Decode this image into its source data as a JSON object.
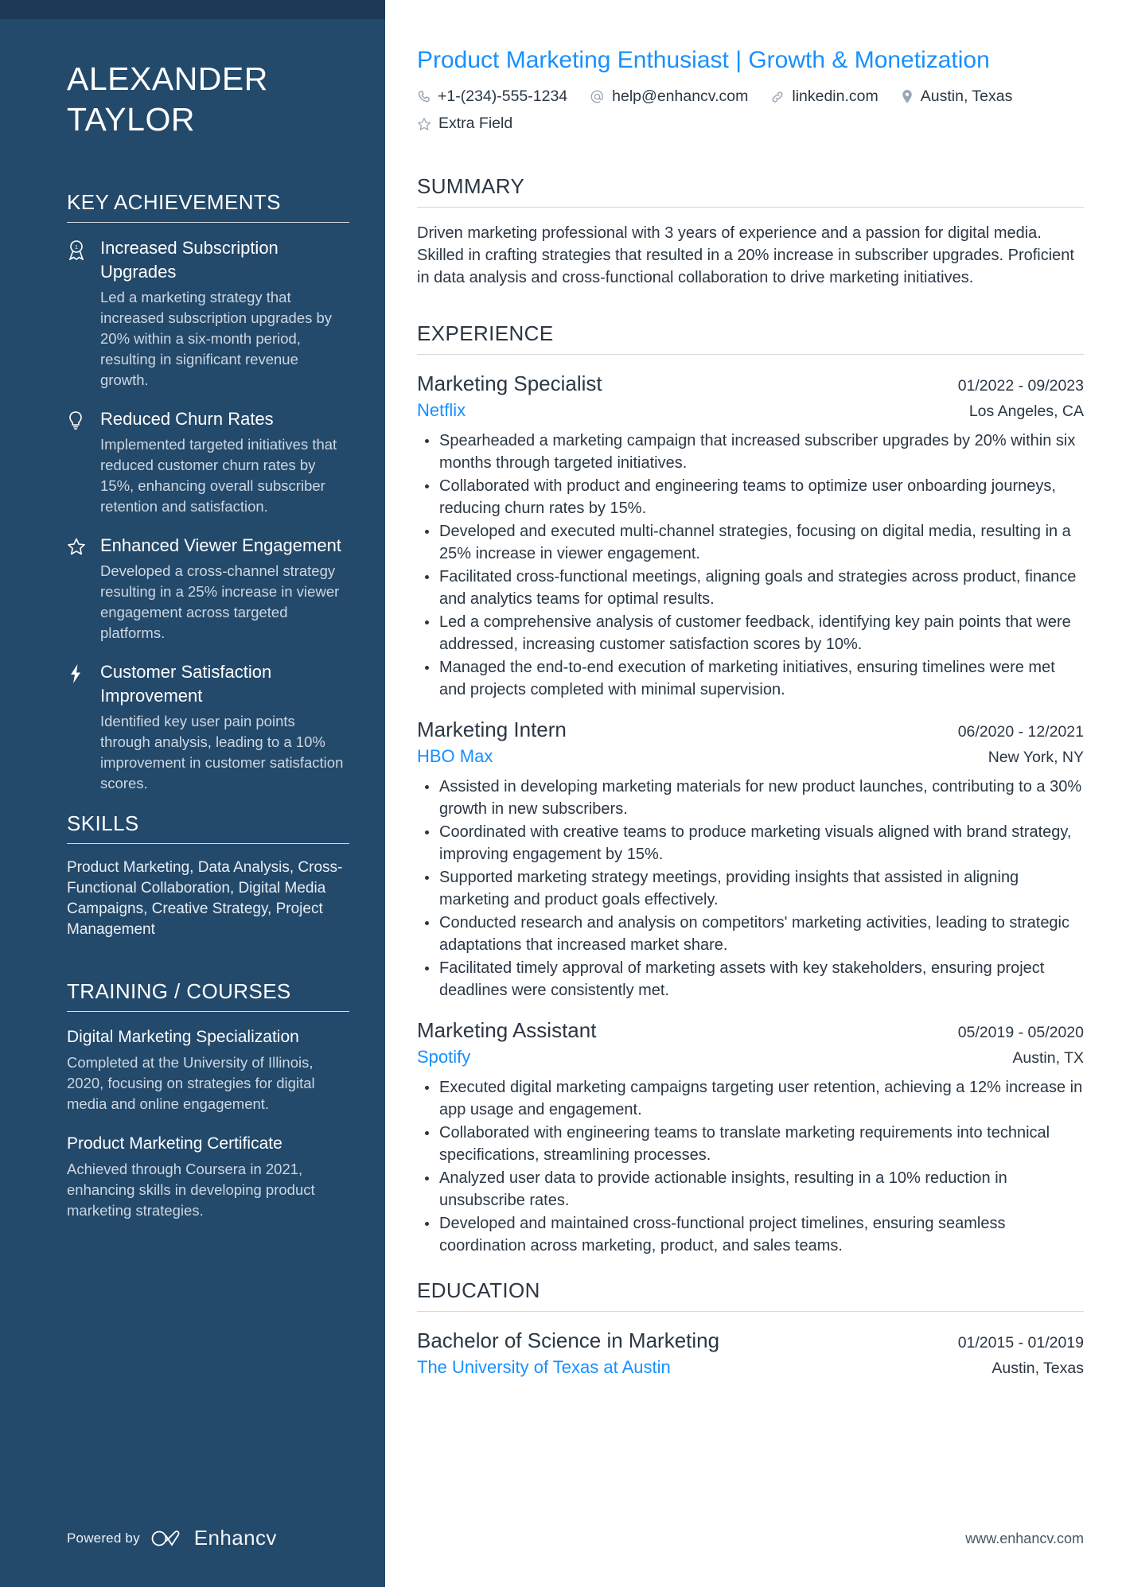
{
  "sidebar": {
    "name_lines": [
      "ALEXANDER",
      "TAYLOR"
    ],
    "achievements_heading": "KEY ACHIEVEMENTS",
    "achievements": [
      {
        "icon": "award-ribbon-icon",
        "title": "Increased Subscription Upgrades",
        "description": "Led a marketing strategy that increased subscription upgrades by 20% within a six-month period, resulting in significant revenue growth."
      },
      {
        "icon": "lightbulb-icon",
        "title": "Reduced Churn Rates",
        "description": "Implemented targeted initiatives that reduced customer churn rates by 15%, enhancing overall subscriber retention and satisfaction."
      },
      {
        "icon": "star-icon",
        "title": "Enhanced Viewer Engagement",
        "description": "Developed a cross-channel strategy resulting in a 25% increase in viewer engagement across targeted platforms."
      },
      {
        "icon": "lightning-bolt-icon",
        "title": "Customer Satisfaction Improvement",
        "description": "Identified key user pain points through analysis, leading to a 10% improvement in customer satisfaction scores."
      }
    ],
    "skills_heading": "SKILLS",
    "skills_text": "Product Marketing, Data Analysis, Cross-Functional Collaboration, Digital Media Campaigns, Creative Strategy, Project Management",
    "training_heading": "TRAINING / COURSES",
    "courses": [
      {
        "title": "Digital Marketing Specialization",
        "description": "Completed at the University of Illinois, 2020, focusing on strategies for digital media and online engagement."
      },
      {
        "title": "Product Marketing Certificate",
        "description": "Achieved through Coursera in 2021, enhancing skills in developing product marketing strategies."
      }
    ],
    "footer": {
      "powered_by": "Powered by",
      "brand": "Enhancv"
    }
  },
  "main": {
    "headline": "Product Marketing Enthusiast | Growth & Monetization",
    "contacts": [
      {
        "icon": "phone-icon",
        "value": "+1-(234)-555-1234"
      },
      {
        "icon": "at-email-icon",
        "value": "help@enhancv.com"
      },
      {
        "icon": "link-icon",
        "value": "linkedin.com"
      },
      {
        "icon": "map-pin-icon",
        "value": "Austin, Texas"
      },
      {
        "icon": "star-icon",
        "value": "Extra Field"
      }
    ],
    "summary_heading": "SUMMARY",
    "summary_text": "Driven marketing professional with 3 years of experience and a passion for digital media. Skilled in crafting strategies that resulted in a 20% increase in subscriber upgrades. Proficient in data analysis and cross-functional collaboration to drive marketing initiatives.",
    "experience_heading": "EXPERIENCE",
    "jobs": [
      {
        "title": "Marketing Specialist",
        "dates": "01/2022 - 09/2023",
        "company": "Netflix",
        "location": "Los Angeles, CA",
        "bullets": [
          "Spearheaded a marketing campaign that increased subscriber upgrades by 20% within six months through targeted initiatives.",
          "Collaborated with product and engineering teams to optimize user onboarding journeys, reducing churn rates by 15%.",
          "Developed and executed multi-channel strategies, focusing on digital media, resulting in a 25% increase in viewer engagement.",
          "Facilitated cross-functional meetings, aligning goals and strategies across product, finance and analytics teams for optimal results.",
          "Led a comprehensive analysis of customer feedback, identifying key pain points that were addressed, increasing customer satisfaction scores by 10%.",
          "Managed the end-to-end execution of marketing initiatives, ensuring timelines were met and projects completed with minimal supervision."
        ]
      },
      {
        "title": "Marketing Intern",
        "dates": "06/2020 - 12/2021",
        "company": "HBO Max",
        "location": "New York, NY",
        "bullets": [
          "Assisted in developing marketing materials for new product launches, contributing to a 30% growth in new subscribers.",
          "Coordinated with creative teams to produce marketing visuals aligned with brand strategy, improving engagement by 15%.",
          "Supported marketing strategy meetings, providing insights that assisted in aligning marketing and product goals effectively.",
          "Conducted research and analysis on competitors' marketing activities, leading to strategic adaptations that increased market share.",
          "Facilitated timely approval of marketing assets with key stakeholders, ensuring project deadlines were consistently met."
        ]
      },
      {
        "title": "Marketing Assistant",
        "dates": "05/2019 - 05/2020",
        "company": "Spotify",
        "location": "Austin, TX",
        "bullets": [
          "Executed digital marketing campaigns targeting user retention, achieving a 12% increase in app usage and engagement.",
          "Collaborated with engineering teams to translate marketing requirements into technical specifications, streamlining processes.",
          "Analyzed user data to provide actionable insights, resulting in a 10% reduction in unsubscribe rates.",
          "Developed and maintained cross-functional project timelines, ensuring seamless coordination across marketing, product, and sales teams."
        ]
      }
    ],
    "education_heading": "EDUCATION",
    "education": [
      {
        "degree": "Bachelor of Science in Marketing",
        "dates": "01/2015 - 01/2019",
        "school": "The University of Texas at Austin",
        "location": "Austin, Texas"
      }
    ],
    "footer_url": "www.enhancv.com"
  },
  "colors": {
    "sidebar_bg": "#23496b",
    "sidebar_topbar": "#1d3a56",
    "accent_blue": "#1890ff",
    "body_text": "#2b3743"
  }
}
